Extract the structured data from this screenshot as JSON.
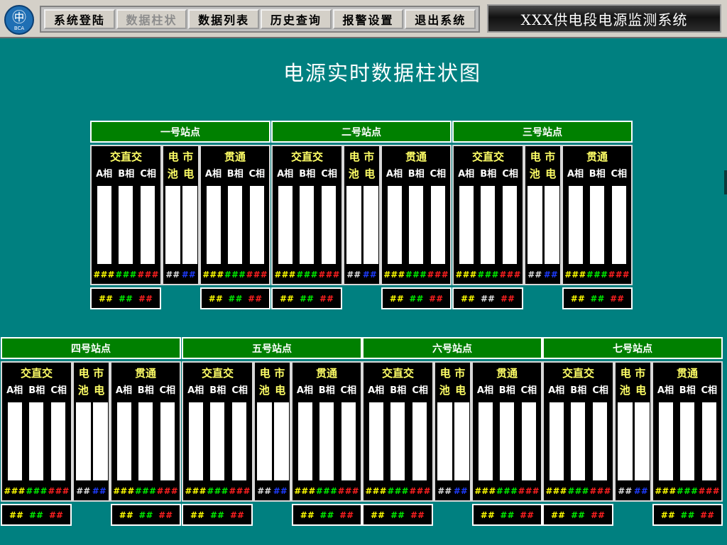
{
  "logo": {
    "mark": "㊥",
    "abbr": "BCA"
  },
  "menu": [
    {
      "label": "系统登陆",
      "enabled": true
    },
    {
      "label": "数据柱状",
      "enabled": false
    },
    {
      "label": "数据列表",
      "enabled": true
    },
    {
      "label": "历史查询",
      "enabled": true
    },
    {
      "label": "报警设置",
      "enabled": true
    },
    {
      "label": "退出系统",
      "enabled": true
    }
  ],
  "app_title": "XXX供电段电源监测系统",
  "page_title": "电源实时数据柱状图",
  "labels": {
    "ac_name": "交直交",
    "dc_top_left": "电",
    "dc_top_right": "市",
    "dc_bottom_left": "池",
    "dc_bottom_right": "电",
    "gt_name": "贯通",
    "phase_a": "A相",
    "phase_b": "B相",
    "phase_c": "C相",
    "value_placeholder": "###",
    "ext_placeholder": "##"
  },
  "colors": {
    "yellow": "#ffff00",
    "green": "#00ee00",
    "red": "#ff2020",
    "white": "#e0e0e0",
    "blue": "#1e3cff",
    "header": "#008000",
    "background": "#008080"
  },
  "stations": [
    {
      "name": "一号站点",
      "ac_fill": [
        1,
        1,
        1
      ],
      "dc_fill": [
        1,
        1
      ],
      "gt_fill": [
        1,
        1,
        1
      ],
      "ext_ac": true,
      "ext_gt": true,
      "ext_ac_first": "yellow"
    },
    {
      "name": "二号站点",
      "ac_fill": [
        1,
        1,
        1
      ],
      "dc_fill": [
        1,
        1
      ],
      "gt_fill": [
        1,
        1,
        1
      ],
      "ext_ac": true,
      "ext_gt": true,
      "ext_ac_first": "yellow"
    },
    {
      "name": "三号站点",
      "ac_fill": [
        1,
        1,
        1
      ],
      "dc_fill": [
        1,
        1
      ],
      "gt_fill": [
        1,
        1,
        1
      ],
      "ext_ac": true,
      "ext_gt": true,
      "ext_ac_first": "yellow",
      "ext_ac_second_white": true
    },
    {
      "name": "四号站点",
      "ac_fill": [
        1,
        1,
        1
      ],
      "dc_fill": [
        1,
        1
      ],
      "gt_fill": [
        1,
        1,
        1
      ],
      "ext_ac": true,
      "ext_gt": true,
      "ext_ac_first": "yellow"
    },
    {
      "name": "五号站点",
      "ac_fill": [
        1,
        1,
        1
      ],
      "dc_fill": [
        1,
        1
      ],
      "gt_fill": [
        1,
        1,
        1
      ],
      "ext_ac": true,
      "ext_gt": true,
      "ext_ac_first": "yellow"
    },
    {
      "name": "六号站点",
      "ac_fill": [
        1,
        1,
        1
      ],
      "dc_fill": [
        1,
        1
      ],
      "gt_fill": [
        1,
        1,
        1
      ],
      "ext_ac": true,
      "ext_gt": true,
      "ext_ac_first": "yellow"
    },
    {
      "name": "七号站点",
      "ac_fill": [
        1,
        1,
        1
      ],
      "dc_fill": [
        1,
        1
      ],
      "gt_fill": [
        1,
        1,
        1
      ],
      "ext_ac": true,
      "ext_gt": true,
      "ext_ac_first": "yellow"
    }
  ]
}
